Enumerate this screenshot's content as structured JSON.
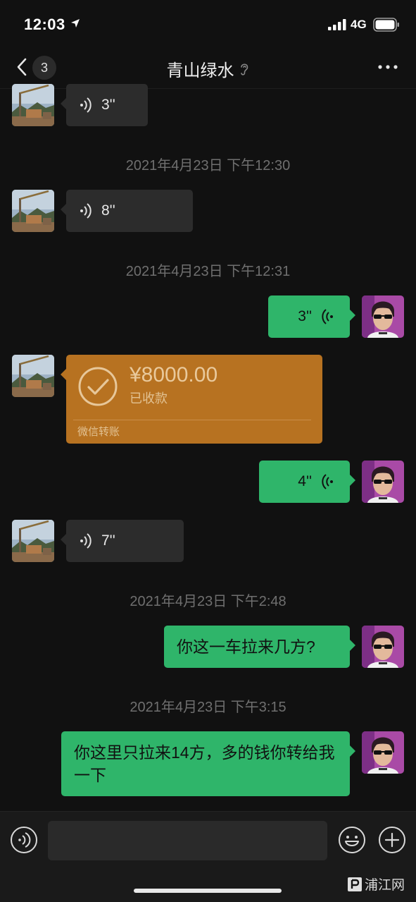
{
  "status_bar": {
    "time": "12:03",
    "network": "4G"
  },
  "nav": {
    "back_badge": "3",
    "title": "青山绿水"
  },
  "messages": {
    "m1": {
      "duration": "3''"
    },
    "ts1": "2021年4月23日 下午12:30",
    "m2": {
      "duration": "8''"
    },
    "ts2": "2021年4月23日 下午12:31",
    "m3": {
      "duration": "3''"
    },
    "m4": {
      "amount": "¥8000.00",
      "status": "已收款",
      "footer": "微信转账"
    },
    "m5": {
      "duration": "4''"
    },
    "m6": {
      "duration": "7''"
    },
    "ts3": "2021年4月23日 下午2:48",
    "m7": {
      "text": "你这一车拉来几方?"
    },
    "ts4": "2021年4月23日 下午3:15",
    "m8": {
      "text": "你这里只拉来14方，多的钱你转给我一下"
    }
  },
  "input_bar": {
    "value": ""
  },
  "watermark": {
    "text": "浦江网"
  },
  "colors": {
    "background": "#111111",
    "incoming_bubble": "#2c2c2c",
    "outgoing_bubble": "#2fb56a",
    "transfer_card": "#b77221"
  }
}
